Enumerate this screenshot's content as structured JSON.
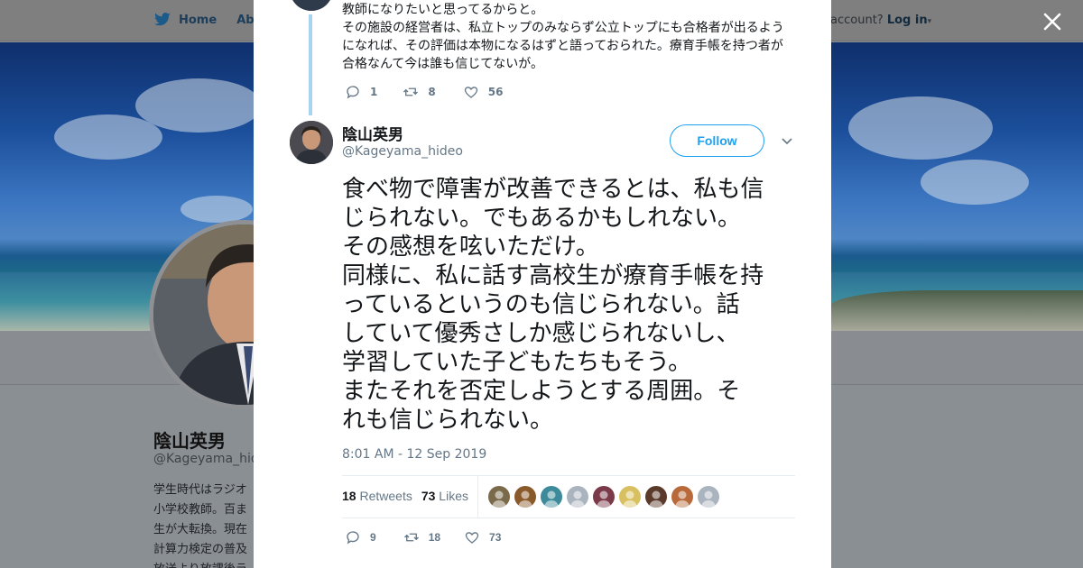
{
  "topbar": {
    "home_label": "Home",
    "about_label": "Abo",
    "account_prompt": "account?",
    "login_label": "Log in"
  },
  "profile": {
    "name": "陰山英男",
    "handle": "@Kageyama_hide",
    "bio_lines": [
      "学生時代はラジオ",
      "小学校教師。百ま",
      "生が大転換。現在",
      "計算力検定の普及",
      "放送より放課後ラ"
    ]
  },
  "previous_tweet": {
    "lines": [
      "教師になりたいと思ってるからと。",
      "その施設の経営者は、私立トップのみならず公立トップにも合格者が出るよう",
      "になれば、その評価は本物になるはずと語っておられた。療育手帳を持つ者が",
      "合格なんて今は誰も信じてないが。"
    ],
    "replies": "1",
    "retweets": "8",
    "likes": "56"
  },
  "tweet": {
    "author_name": "陰山英男",
    "author_handle": "@Kageyama_hideo",
    "follow_label": "Follow",
    "lines": [
      "食べ物で障害が改善できるとは、私も信",
      "じられない。でもあるかもしれない。",
      "その感想を呟いただけ。",
      "同様に、私に話す高校生が療育手帳を持",
      "っているというのも信じられない。話",
      "していて優秀さしか感じられないし、",
      "学習していた子どもたちもそう。",
      "またそれを否定しようとする周囲。そ",
      "れも信じられない。"
    ],
    "timestamp": "8:01 AM - 12 Sep 2019",
    "retweet_count": "18",
    "retweet_label": "Retweets",
    "like_count": "73",
    "like_label": "Likes",
    "replies": "9",
    "retweets": "18",
    "likes": "73"
  },
  "likers": [
    {
      "color": "#7a6a4a"
    },
    {
      "color": "#8a5a2a"
    },
    {
      "color": "#3c8a9a"
    },
    {
      "color": "#aab4be"
    },
    {
      "color": "#7a3a4a"
    },
    {
      "color": "#d8c060"
    },
    {
      "color": "#5a3a2a"
    },
    {
      "color": "#b86a3a"
    },
    {
      "color": "#aab4be"
    }
  ],
  "colors": {
    "accent": "#1da1f2",
    "secondary_text": "#657786",
    "thread_line": "#a8d4f2"
  }
}
